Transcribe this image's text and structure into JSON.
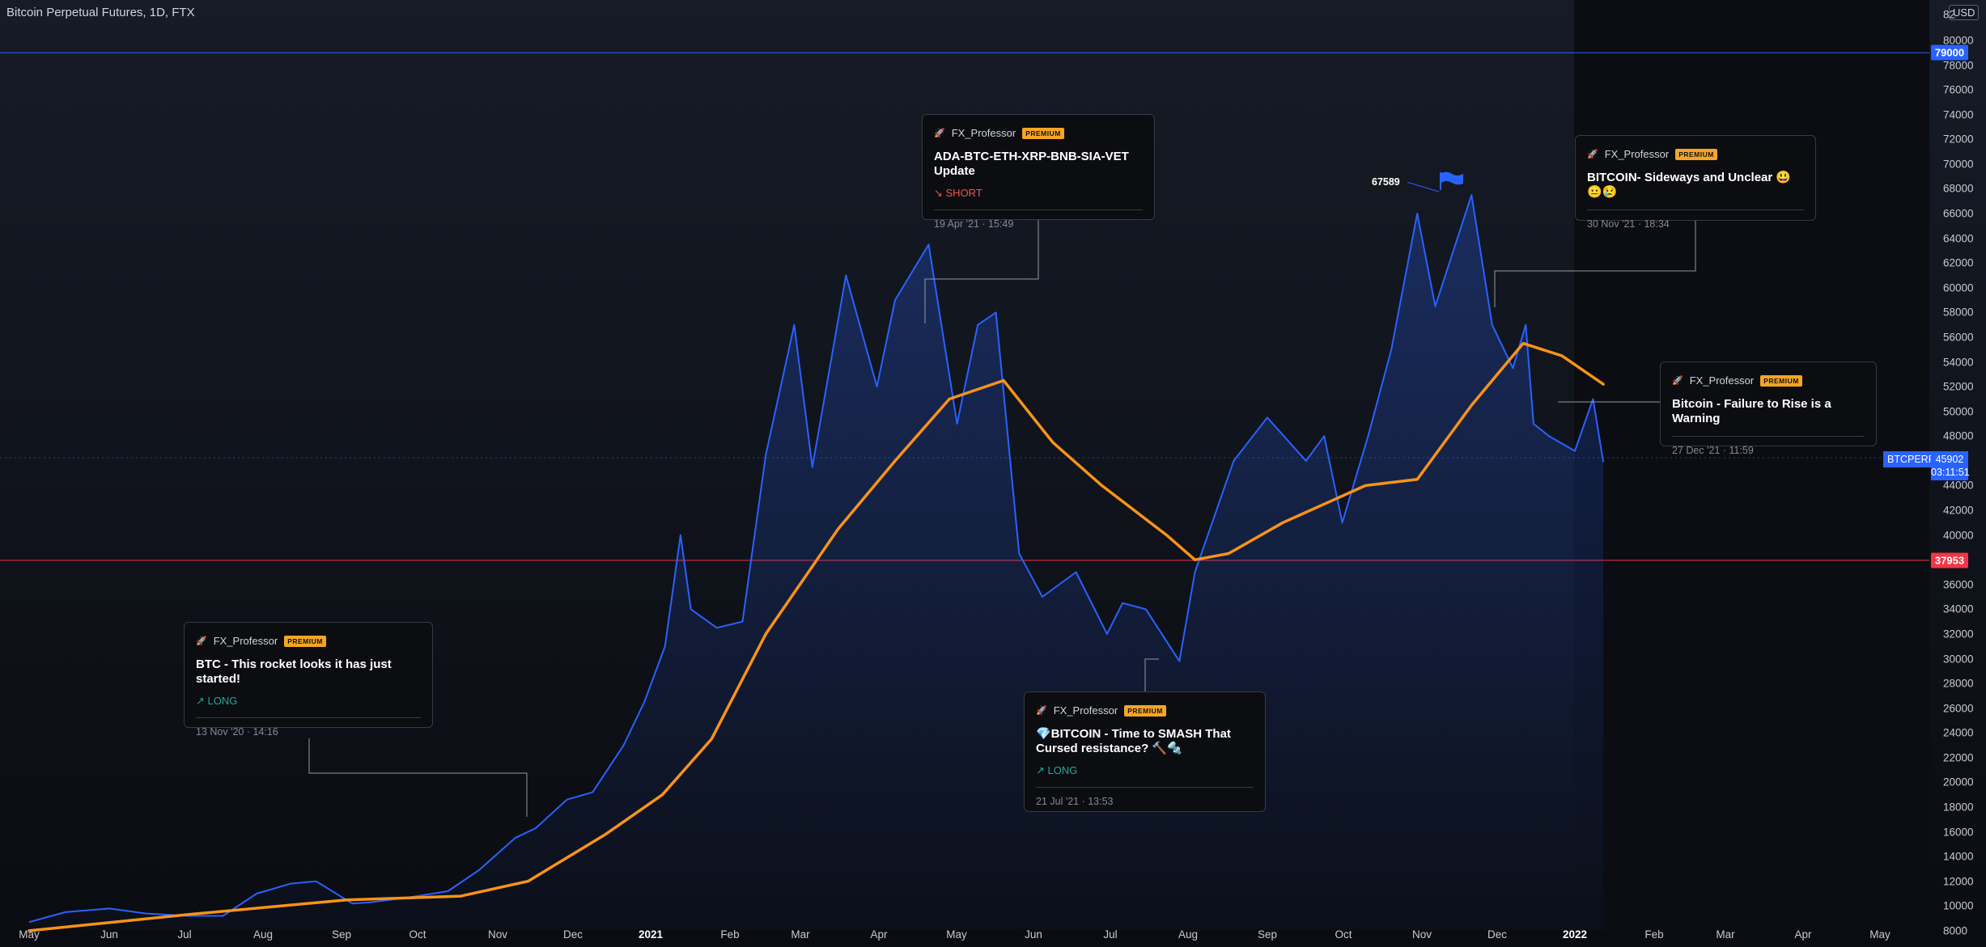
{
  "header": {
    "title": "Bitcoin Perpetual Futures, 1D, FTX",
    "currency": "USD"
  },
  "axes": {
    "y_ticks": [
      "80000",
      "78000",
      "76000",
      "74000",
      "72000",
      "70000",
      "68000",
      "66000",
      "64000",
      "62000",
      "60000",
      "58000",
      "56000",
      "54000",
      "52000",
      "50000",
      "48000",
      "44000",
      "42000",
      "40000",
      "36000",
      "34000",
      "32000",
      "30000",
      "28000",
      "26000",
      "24000",
      "22000",
      "20000",
      "18000",
      "16000",
      "14000",
      "12000",
      "10000",
      "8000"
    ],
    "y_top_partial": "82",
    "x_ticks": [
      {
        "label": "May",
        "year": false
      },
      {
        "label": "Jun",
        "year": false
      },
      {
        "label": "Jul",
        "year": false
      },
      {
        "label": "Aug",
        "year": false
      },
      {
        "label": "Sep",
        "year": false
      },
      {
        "label": "Oct",
        "year": false
      },
      {
        "label": "Nov",
        "year": false
      },
      {
        "label": "Dec",
        "year": false
      },
      {
        "label": "2021",
        "year": true
      },
      {
        "label": "Feb",
        "year": false
      },
      {
        "label": "Mar",
        "year": false
      },
      {
        "label": "Apr",
        "year": false
      },
      {
        "label": "May",
        "year": false
      },
      {
        "label": "Jun",
        "year": false
      },
      {
        "label": "Jul",
        "year": false
      },
      {
        "label": "Aug",
        "year": false
      },
      {
        "label": "Sep",
        "year": false
      },
      {
        "label": "Oct",
        "year": false
      },
      {
        "label": "Nov",
        "year": false
      },
      {
        "label": "Dec",
        "year": false
      },
      {
        "label": "2022",
        "year": true
      },
      {
        "label": "Feb",
        "year": false
      },
      {
        "label": "Mar",
        "year": false
      },
      {
        "label": "Apr",
        "year": false
      },
      {
        "label": "May",
        "year": false
      }
    ]
  },
  "price_lines": {
    "upper": {
      "label": "79000",
      "value": 79000,
      "color": "#2962ff"
    },
    "lower": {
      "label": "37953",
      "value": 37953,
      "color": "#f23645"
    }
  },
  "last_price": {
    "symbol": "BTCPERP",
    "price": "45902",
    "countdown": "03:11:51",
    "value": 45902
  },
  "peak_callout": {
    "label": "67589"
  },
  "ideas": [
    {
      "author": "FX_Professor",
      "badge": "PREMIUM",
      "title": "BTC - This rocket looks it has just started!",
      "direction": "↗ LONG",
      "dir_class": "long",
      "timestamp": "13 Nov '20 · 14:16"
    },
    {
      "author": "FX_Professor",
      "badge": "PREMIUM",
      "title": "ADA-BTC-ETH-XRP-BNB-SIA-VET Update",
      "direction": "↘ SHORT",
      "dir_class": "short",
      "timestamp": "19 Apr '21 · 15:49"
    },
    {
      "author": "FX_Professor",
      "badge": "PREMIUM",
      "title": "💎BITCOIN - Time to SMASH That Cursed resistance? 🔨🔩",
      "direction": "↗ LONG",
      "dir_class": "long",
      "timestamp": "21 Jul '21 · 13:53"
    },
    {
      "author": "FX_Professor",
      "badge": "PREMIUM",
      "title": "BITCOIN- Sideways and Unclear 😃😐😢",
      "direction": "",
      "dir_class": "",
      "timestamp": "30 Nov '21 · 18:34"
    },
    {
      "author": "FX_Professor",
      "badge": "PREMIUM",
      "title": "Bitcoin - Failure to Rise is a Warning",
      "direction": "",
      "dir_class": "",
      "timestamp": "27 Dec '21 · 11:59"
    }
  ],
  "colors": {
    "price_line": "#2962ff",
    "ma_line": "#f7931a",
    "background": "#131722",
    "accent": "#2962ff"
  },
  "chart_data": {
    "type": "line",
    "title": "Bitcoin Perpetual Futures, 1D, FTX",
    "xlabel": "",
    "ylabel": "",
    "ylim": [
      8000,
      82000
    ],
    "y_scale": "linear",
    "grid": false,
    "series": [
      {
        "x": [
          "2020-05-01",
          "2020-05-15",
          "2020-06-01",
          "2020-06-15",
          "2020-07-01",
          "2020-07-15",
          "2020-07-28",
          "2020-08-10",
          "2020-08-20",
          "2020-09-03",
          "2020-09-10",
          "2020-09-25",
          "2020-10-10",
          "2020-10-22",
          "2020-11-05",
          "2020-11-13",
          "2020-11-25",
          "2020-12-05",
          "2020-12-17",
          "2020-12-25",
          "2021-01-02",
          "2021-01-08",
          "2021-01-12",
          "2021-01-22",
          "2021-02-01",
          "2021-02-10",
          "2021-02-21",
          "2021-02-28",
          "2021-03-13",
          "2021-03-25",
          "2021-04-01",
          "2021-04-14",
          "2021-04-25",
          "2021-05-03",
          "2021-05-10",
          "2021-05-19",
          "2021-05-28",
          "2021-06-10",
          "2021-06-22",
          "2021-06-28",
          "2021-07-07",
          "2021-07-20",
          "2021-07-26",
          "2021-08-10",
          "2021-08-23",
          "2021-09-07",
          "2021-09-14",
          "2021-09-21",
          "2021-10-01",
          "2021-10-10",
          "2021-10-20",
          "2021-10-27",
          "2021-11-03",
          "2021-11-10",
          "2021-11-18",
          "2021-11-26",
          "2021-12-01",
          "2021-12-04",
          "2021-12-10",
          "2021-12-20",
          "2021-12-27",
          "2021-12-31"
        ],
        "values": [
          8700,
          9500,
          9800,
          9400,
          9200,
          9200,
          11000,
          11800,
          12000,
          10200,
          10300,
          10700,
          11200,
          12900,
          15500,
          16300,
          18600,
          19200,
          23000,
          26500,
          31000,
          40000,
          34000,
          32500,
          33000,
          46500,
          57000,
          45500,
          61000,
          52000,
          59000,
          63500,
          49000,
          57000,
          58000,
          38500,
          35000,
          37000,
          32000,
          34500,
          34000,
          29800,
          37000,
          46000,
          49500,
          46000,
          48000,
          41000,
          48000,
          55000,
          66000,
          58500,
          63000,
          67500,
          57000,
          53500,
          57000,
          49000,
          48000,
          46800,
          51000,
          45902
        ]
      },
      {
        "x": [
          "2020-05-01",
          "2020-07-01",
          "2020-09-01",
          "2020-10-15",
          "2020-11-10",
          "2020-12-10",
          "2021-01-01",
          "2021-01-20",
          "2021-02-10",
          "2021-03-10",
          "2021-04-01",
          "2021-04-22",
          "2021-05-13",
          "2021-06-01",
          "2021-06-20",
          "2021-07-15",
          "2021-07-26",
          "2021-08-08",
          "2021-08-29",
          "2021-09-30",
          "2021-10-20",
          "2021-11-10",
          "2021-11-30",
          "2021-12-15",
          "2021-12-31"
        ],
        "values": [
          8000,
          9300,
          10500,
          10800,
          12000,
          15800,
          19000,
          23500,
          32000,
          40500,
          46000,
          51000,
          52500,
          47500,
          44000,
          40000,
          38000,
          38500,
          41000,
          44000,
          44500,
          50500,
          55500,
          54500,
          52200
        ]
      }
    ]
  }
}
